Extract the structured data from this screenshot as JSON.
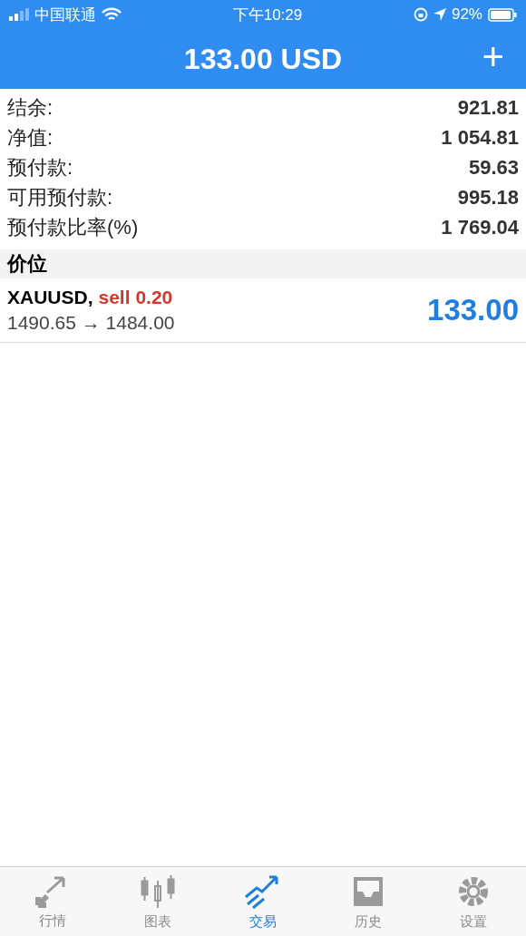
{
  "status_bar": {
    "carrier": "中国联通",
    "time": "下午10:29",
    "battery": "92%"
  },
  "header": {
    "title": "133.00 USD",
    "add_button": "+"
  },
  "summary": [
    {
      "label": "结余:",
      "value": "921.81"
    },
    {
      "label": "净值:",
      "value": "1 054.81"
    },
    {
      "label": "预付款:",
      "value": "59.63"
    },
    {
      "label": "可用预付款:",
      "value": "995.18"
    },
    {
      "label": "预付款比率(%)",
      "value": "1 769.04"
    }
  ],
  "section": {
    "title": "价位"
  },
  "positions": [
    {
      "symbol": "XAUUSD,",
      "order": "sell 0.20",
      "kind": "sell",
      "prices": "1490.65 → 1484.00",
      "profit": "133.00"
    }
  ],
  "tab_bar": [
    {
      "label": "行情",
      "kind": "arrows",
      "selected": false
    },
    {
      "label": "图表",
      "kind": "candles",
      "selected": false
    },
    {
      "label": "交易",
      "kind": "trend",
      "selected": true
    },
    {
      "label": "历史",
      "kind": "inbox",
      "selected": false
    },
    {
      "label": "设置",
      "kind": "gear",
      "selected": false
    }
  ]
}
